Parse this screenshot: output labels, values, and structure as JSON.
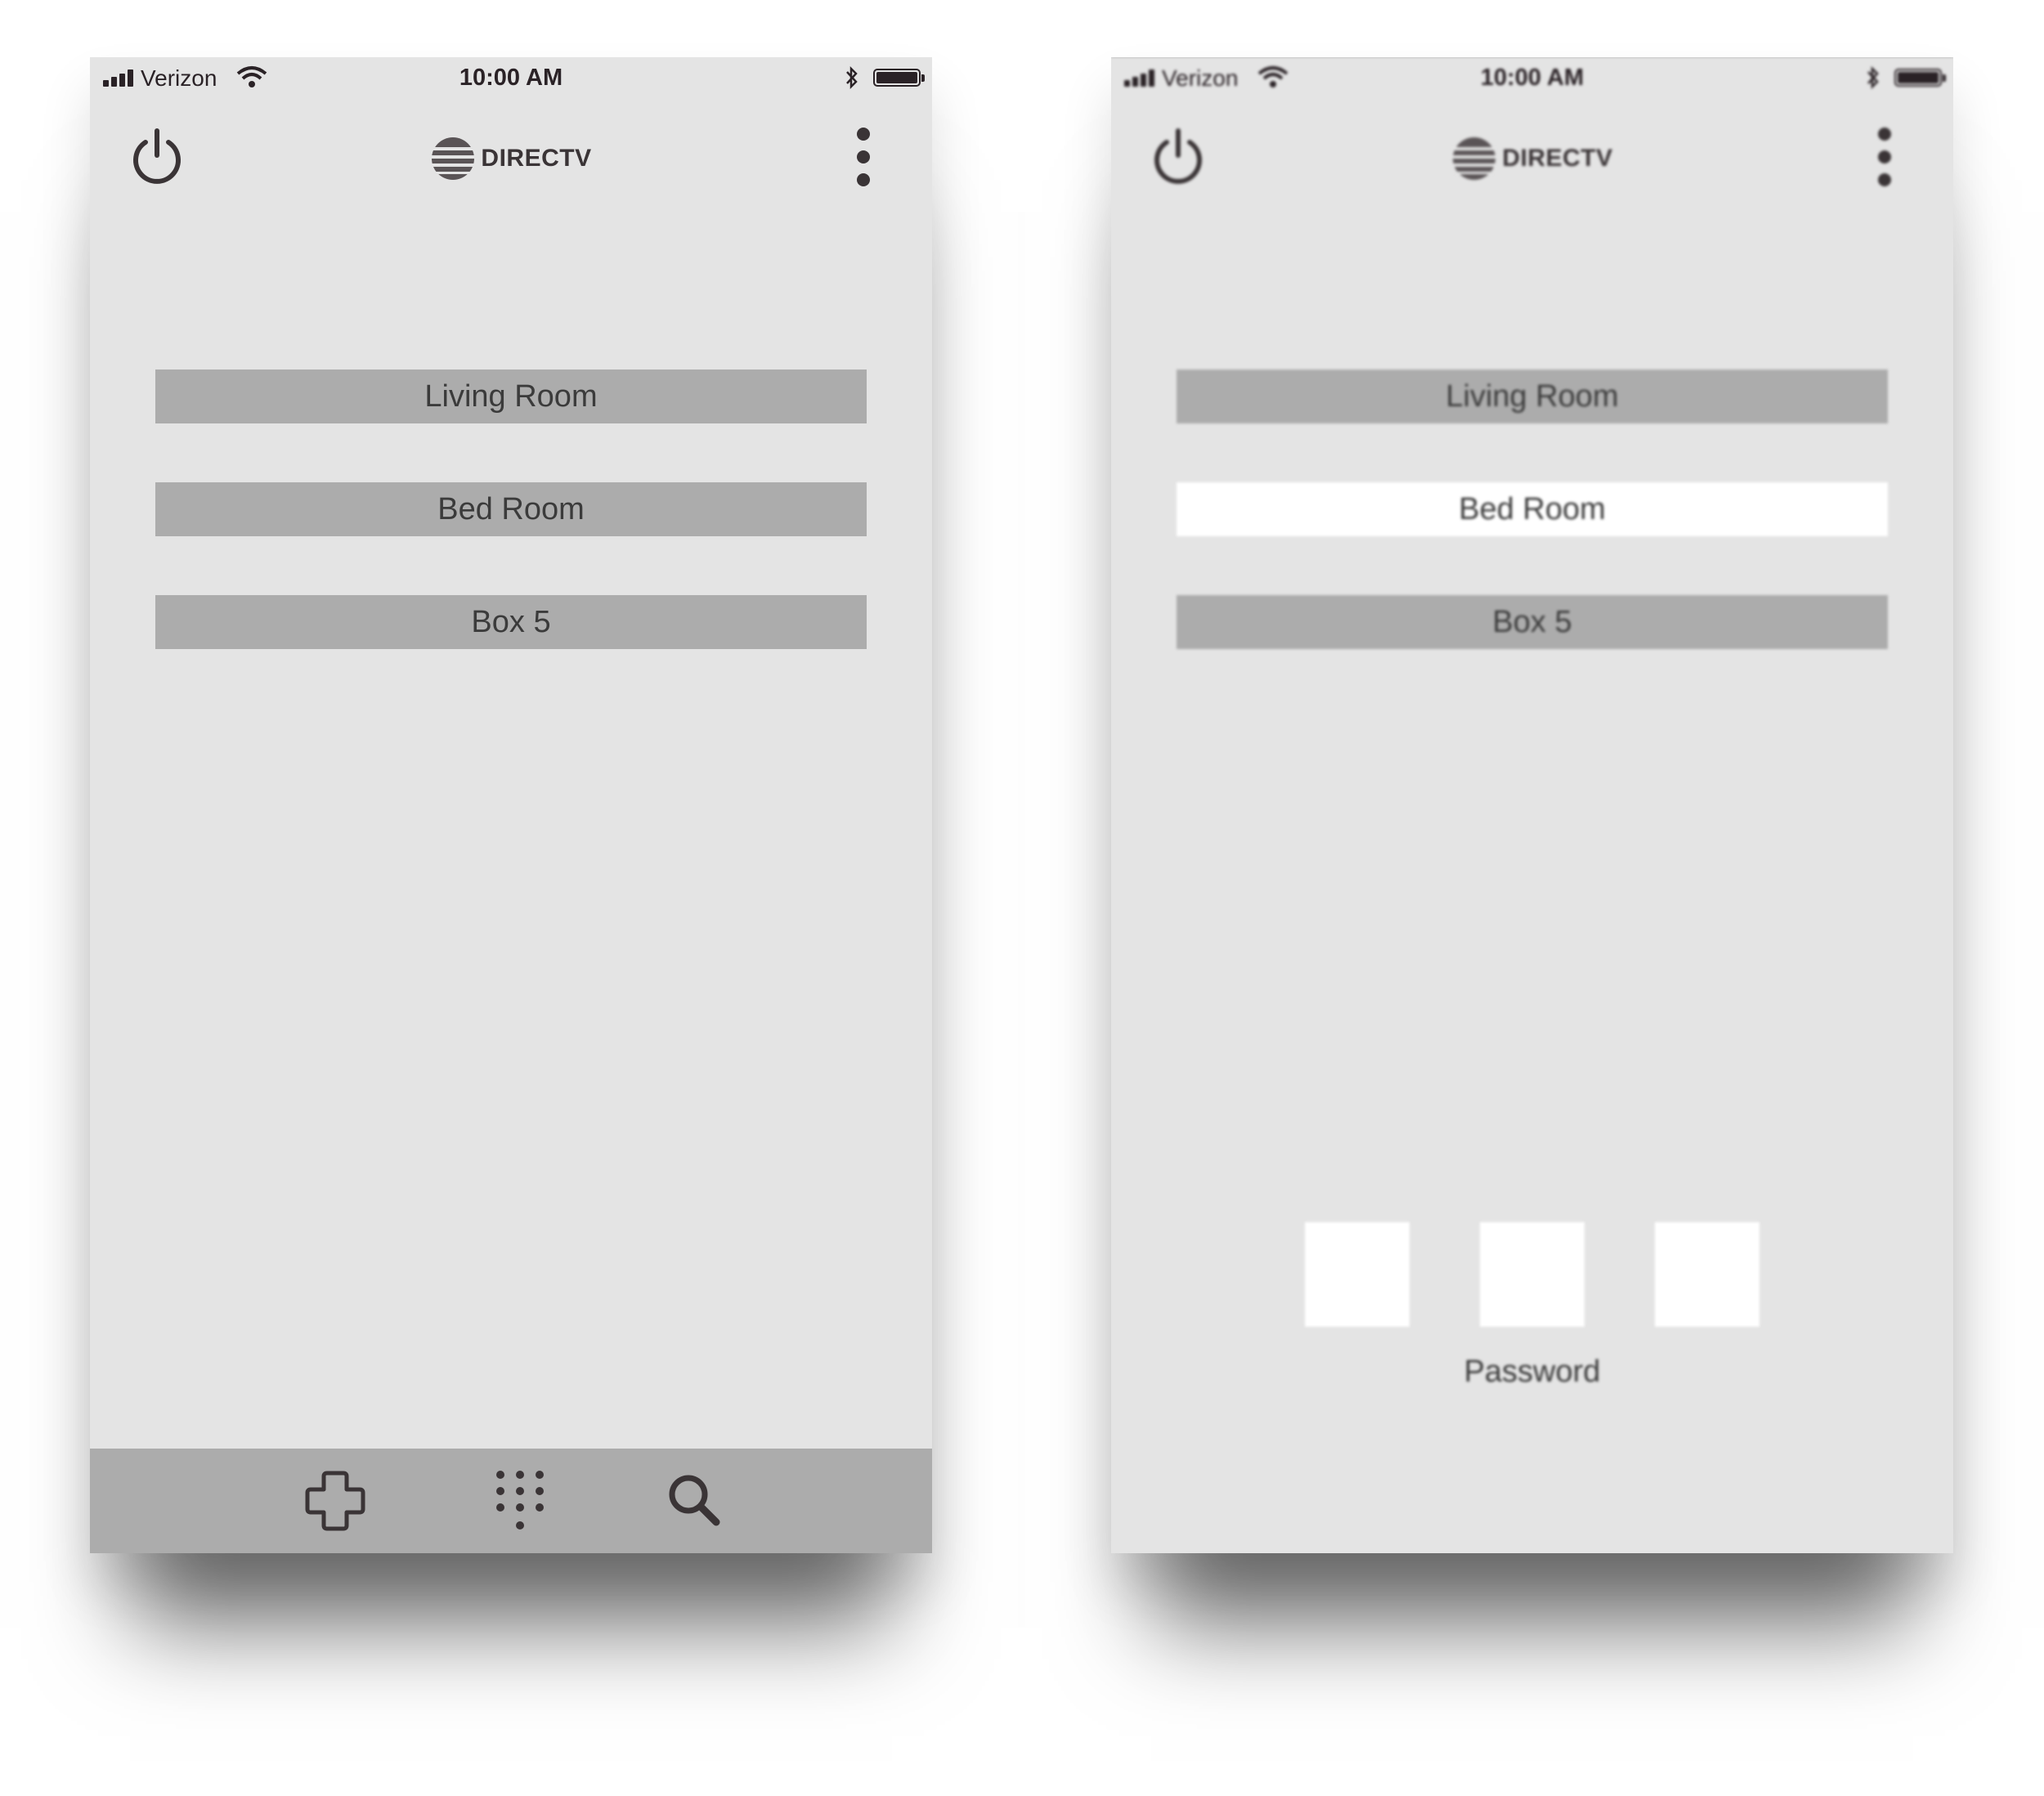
{
  "screens": [
    {
      "id": "left",
      "status_bar": {
        "carrier": "Verizon",
        "time": "10:00 AM"
      },
      "header": {
        "brand": "DIRECTV",
        "power_icon": "power-icon",
        "menu_icon": "more-vertical-icon"
      },
      "devices": [
        {
          "label": "Living Room",
          "selected": false
        },
        {
          "label": "Bed Room",
          "selected": false
        },
        {
          "label": "Box 5",
          "selected": false
        }
      ],
      "bottom_nav": [
        "dpad-icon",
        "keypad-icon",
        "search-icon"
      ]
    },
    {
      "id": "right",
      "status_bar": {
        "carrier": "Verizon",
        "time": "10:00 AM"
      },
      "header": {
        "brand": "DIRECTV",
        "power_icon": "power-icon",
        "menu_icon": "more-vertical-icon"
      },
      "devices": [
        {
          "label": "Living Room",
          "selected": false
        },
        {
          "label": "Bed Room",
          "selected": true
        },
        {
          "label": "Box 5",
          "selected": false
        }
      ],
      "password": {
        "label": "Password",
        "digits": 3
      },
      "bottom_nav": [
        "dpad-icon",
        "keypad-icon",
        "search-icon"
      ]
    }
  ],
  "colors": {
    "screen_bg": "#e4e4e4",
    "list_item_bg": "#acacac",
    "selected_item_bg": "#ffffff",
    "bottom_bar_bg": "#acacac",
    "icon_color": "#3a3436"
  }
}
